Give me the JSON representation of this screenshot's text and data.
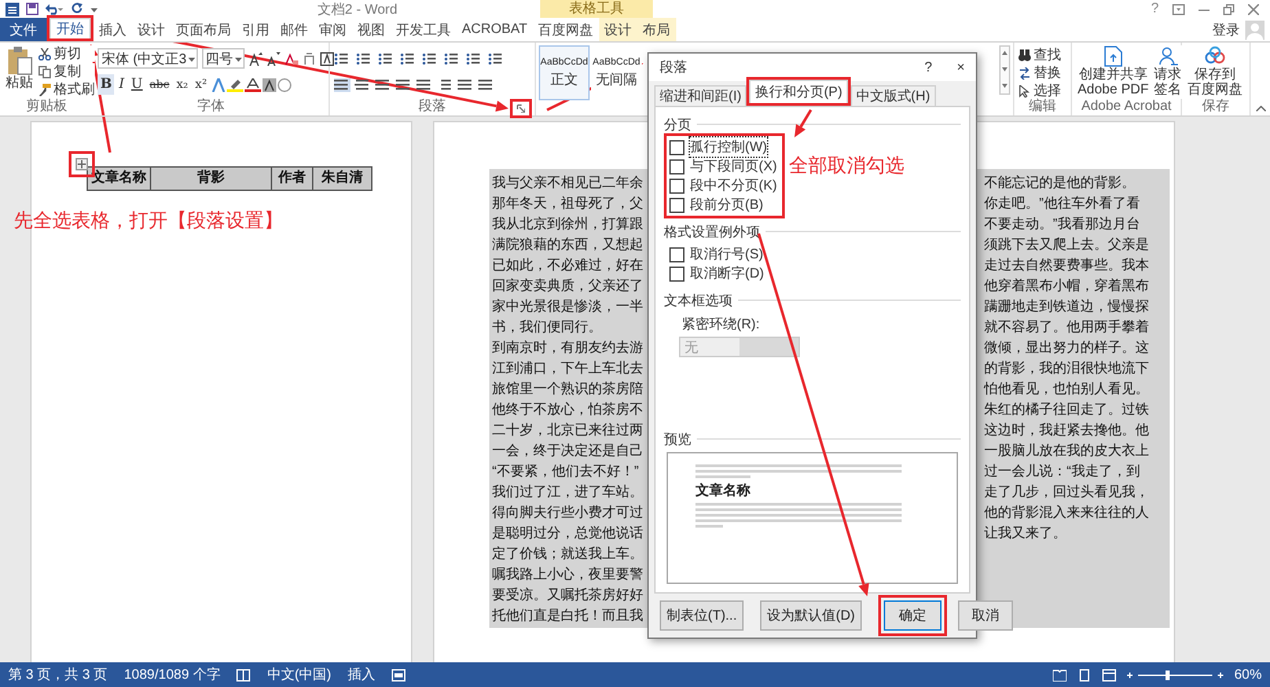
{
  "window": {
    "title": "文档2 - Word",
    "context_group": "表格工具",
    "help": "?",
    "sign_in": "登录"
  },
  "tabs": [
    {
      "label": "文件",
      "kind": "file",
      "selected": false,
      "highlighted": false
    },
    {
      "label": "开始",
      "kind": "main",
      "selected": true,
      "highlighted": true
    },
    {
      "label": "插入",
      "kind": "main",
      "selected": false,
      "highlighted": false
    },
    {
      "label": "设计",
      "kind": "main",
      "selected": false,
      "highlighted": false
    },
    {
      "label": "页面布局",
      "kind": "main",
      "selected": false,
      "highlighted": false
    },
    {
      "label": "引用",
      "kind": "main",
      "selected": false,
      "highlighted": false
    },
    {
      "label": "邮件",
      "kind": "main",
      "selected": false,
      "highlighted": false
    },
    {
      "label": "审阅",
      "kind": "main",
      "selected": false,
      "highlighted": false
    },
    {
      "label": "视图",
      "kind": "main",
      "selected": false,
      "highlighted": false
    },
    {
      "label": "开发工具",
      "kind": "main",
      "selected": false,
      "highlighted": false
    },
    {
      "label": "ACROBAT",
      "kind": "main",
      "selected": false,
      "highlighted": false
    },
    {
      "label": "百度网盘",
      "kind": "main",
      "selected": false,
      "highlighted": false
    },
    {
      "label": "设计",
      "kind": "context",
      "selected": false,
      "highlighted": false
    },
    {
      "label": "布局",
      "kind": "context",
      "selected": false,
      "highlighted": false
    }
  ],
  "ribbon": {
    "clipboard": {
      "label": "剪贴板",
      "paste": "粘贴",
      "cut": "剪切",
      "copy": "复制",
      "format_painter": "格式刷"
    },
    "font": {
      "label": "字体",
      "font_name": "宋体 (中文正3",
      "font_size": "四号",
      "format_buttons": [
        "B",
        "I",
        "U",
        "abc",
        "x₂",
        "x²"
      ]
    },
    "paragraph": {
      "label": "段落"
    },
    "styles": [
      {
        "sample": "AaBbCcDd",
        "name": "正文",
        "selected": true
      },
      {
        "sample": "AaBbCcDd",
        "name": "无间隔",
        "selected": false
      }
    ],
    "editing": {
      "label": "编辑",
      "find": "查找",
      "replace": "替换",
      "select": "选择"
    },
    "acrobat": {
      "label": "Adobe Acrobat",
      "create_pdf": [
        "创建并共享",
        "Adobe PDF"
      ],
      "request_signature": [
        "请求",
        "签名"
      ]
    },
    "save": {
      "label": "保存",
      "save_to_cloud": [
        "保存到",
        "百度网盘"
      ]
    }
  },
  "document": {
    "table_cells": [
      "文章名称",
      "背影",
      "作者",
      "朱自清"
    ],
    "lines": [
      {
        "left": "我与父亲不相见已二年余",
        "right": "不能忘记的是他的背影。"
      },
      {
        "left": "那年冬天，祖母死了，父",
        "right": "你走吧。”他往车外看了看"
      },
      {
        "left": "我从北京到徐州，打算跟",
        "right": "不要走动。”我看那边月台"
      },
      {
        "left": "满院狼藉的东西，又想起",
        "right": "须跳下去又爬上去。父亲是"
      },
      {
        "left": "已如此，不必难过，好在",
        "right": "走过去自然要费事些。我本"
      },
      {
        "left": "回家变卖典质，父亲还了",
        "right": "他穿着黑布小帽，穿着黑布"
      },
      {
        "left": "家中光景很是惨淡，一半",
        "right": "蹒跚地走到铁道边，慢慢探"
      },
      {
        "left": "书，我们便同行。",
        "right": "就不容易了。他用两手攀着"
      },
      {
        "left": "到南京时，有朋友约去游",
        "right": "微倾，显出努力的样子。这"
      },
      {
        "left": "江到浦口，下午上车北去",
        "right": "的背影，我的泪很快地流下"
      },
      {
        "left": "旅馆里一个熟识的茶房陪",
        "right": "怕他看见，也怕别人看见。"
      },
      {
        "left": "他终于不放心，怕茶房不",
        "right": "朱红的橘子往回走了。过铁"
      },
      {
        "left": "二十岁，北京已来往过两",
        "right": "这边时，我赶紧去搀他。他"
      },
      {
        "left": "一会，终于决定还是自己",
        "right": "一股脑儿放在我的皮大衣上"
      },
      {
        "left": "“不要紧，他们去不好！”",
        "right": "过一会儿说：“我走了，到"
      },
      {
        "left": "我们过了江，进了车站。",
        "right": "走了几步，回过头看见我，"
      },
      {
        "left": "得向脚夫行些小费才可过",
        "right": "他的背影混入来来往往的人"
      },
      {
        "left": "是聪明过分，总觉他说话",
        "right": "让我又来了。"
      },
      {
        "left": "定了价钱；就送我上车。"
      },
      {
        "left": "嘱我路上小心，夜里要警"
      },
      {
        "left": "要受凉。又嘱托茶房好好"
      },
      {
        "left": "托他们直是白托！而且我"
      }
    ]
  },
  "dialog": {
    "title": "段落",
    "help": "?",
    "close": "×",
    "tabs": [
      {
        "label": "缩进和间距(I)",
        "selected": false,
        "highlighted": false
      },
      {
        "label": "换行和分页(P)",
        "selected": true,
        "highlighted": true
      },
      {
        "label": "中文版式(H)",
        "selected": false,
        "highlighted": false
      }
    ],
    "sections": [
      {
        "heading": "分页",
        "highlighted": true,
        "options": [
          {
            "label": "孤行控制(W)",
            "checked": false,
            "focused": true
          },
          {
            "label": "与下段同页(X)",
            "checked": false,
            "focused": false
          },
          {
            "label": "段中不分页(K)",
            "checked": false,
            "focused": false
          },
          {
            "label": "段前分页(B)",
            "checked": false,
            "focused": false
          }
        ]
      },
      {
        "heading": "格式设置例外项",
        "highlighted": false,
        "options": [
          {
            "label": "取消行号(S)",
            "checked": false,
            "focused": false
          },
          {
            "label": "取消断字(D)",
            "checked": false,
            "focused": false
          }
        ]
      },
      {
        "heading": "文本框选项"
      }
    ],
    "tight_wrap": {
      "label": "紧密环绕(R):",
      "value": "无",
      "disabled": true
    },
    "preview": {
      "heading": "预览",
      "sample": "文章名称"
    },
    "buttons": [
      {
        "label": "制表位(T)...",
        "default": false,
        "highlighted": false
      },
      {
        "label": "设为默认值(D)",
        "default": false,
        "highlighted": false
      },
      {
        "label": "确定",
        "default": true,
        "highlighted": true
      },
      {
        "label": "取消",
        "default": false,
        "highlighted": false
      }
    ]
  },
  "annotations": [
    {
      "text": "先全选表格，打开【段落设置】",
      "kind": "left"
    },
    {
      "text": "全部取消勾选",
      "kind": "dialog"
    }
  ],
  "status_bar": {
    "page": "第 3 页，共 3 页",
    "words": "1089/1089 个字",
    "language": "中文(中国)",
    "mode": "插入",
    "zoom": "60%"
  }
}
